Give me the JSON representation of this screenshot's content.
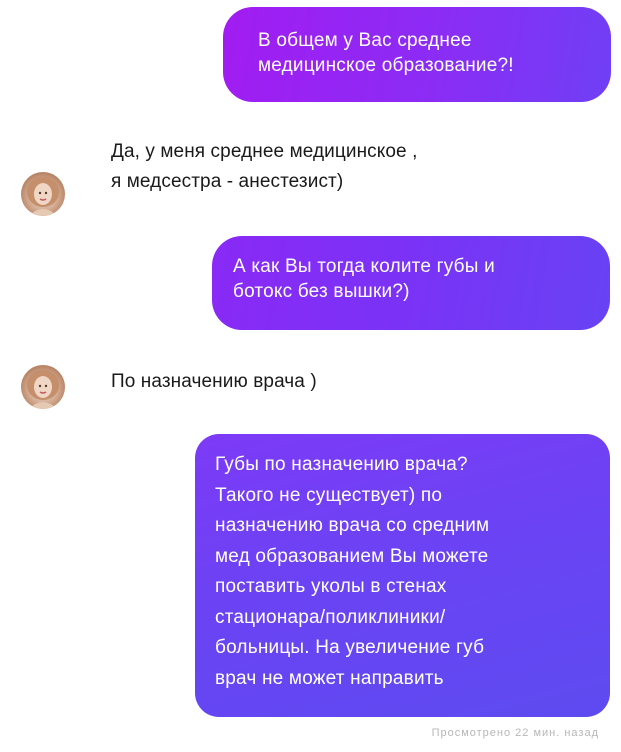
{
  "messages": [
    {
      "direction": "outgoing",
      "lines": [
        "В общем у Вас среднее",
        "медицинское образование?!"
      ]
    },
    {
      "direction": "incoming",
      "lines": [
        "Да, у меня среднее медицинское ,",
        "я медсестра - анестезист)"
      ]
    },
    {
      "direction": "outgoing",
      "lines": [
        "А как Вы тогда колите губы и",
        "ботокс без вышки?)"
      ]
    },
    {
      "direction": "incoming",
      "lines": [
        "По назначению врача )"
      ]
    },
    {
      "direction": "outgoing",
      "lines": [
        "Губы по назначению врача?",
        "Такого не существует) по",
        "назначению врача со средним",
        "мед образованием Вы можете",
        "поставить уколы в стенах",
        "стационара/поликлиники/",
        "больницы. На увеличение губ",
        "врач не может направить"
      ]
    }
  ],
  "seen_status": "Просмотрено 22 мин. назад",
  "contact": {
    "avatar_icon": "profile-avatar"
  },
  "colors": {
    "outgoing_gradient_start": "#a21cf2",
    "outgoing_gradient_end": "#5d4bf0",
    "incoming_text": "#1a1a1a",
    "background": "#ffffff"
  }
}
